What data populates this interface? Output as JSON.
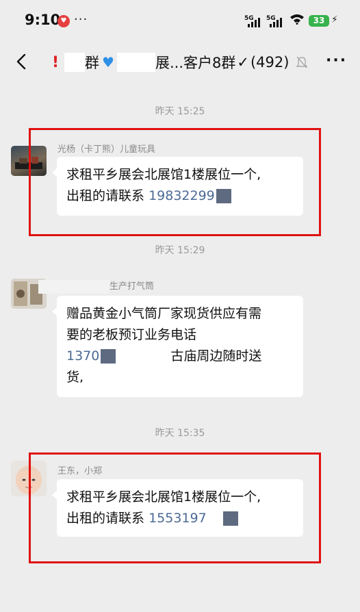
{
  "status": {
    "time": "9:10",
    "network_1": "5G",
    "network_2": "5G",
    "battery": "33"
  },
  "header": {
    "title_prefix": "群",
    "title_suffix": "展...客户8群",
    "check": "✓",
    "member_count": "(492)"
  },
  "messages": [
    {
      "timestamp": "昨天 15:25",
      "sender": "光杨（卡丁熊）儿童玩具",
      "line1": "求租平乡展会北展馆1楼展位一个,",
      "line2_text": "出租的请联系",
      "phone": "19832299"
    },
    {
      "timestamp": "昨天 15:29",
      "sender": "生产打气筒",
      "line1": "赠品黄金小气筒厂家现货供应有需",
      "line2": "要的老板预订业务电话",
      "phone": "1370",
      "line3_rest": "古庙周边随时送",
      "line4": "货,"
    },
    {
      "timestamp": "昨天 15:35",
      "sender": "王东，小郑",
      "line1": "求租平乡展会北展馆1楼展位一个,",
      "line2_text": "出租的请联系",
      "phone": "1553197"
    }
  ]
}
